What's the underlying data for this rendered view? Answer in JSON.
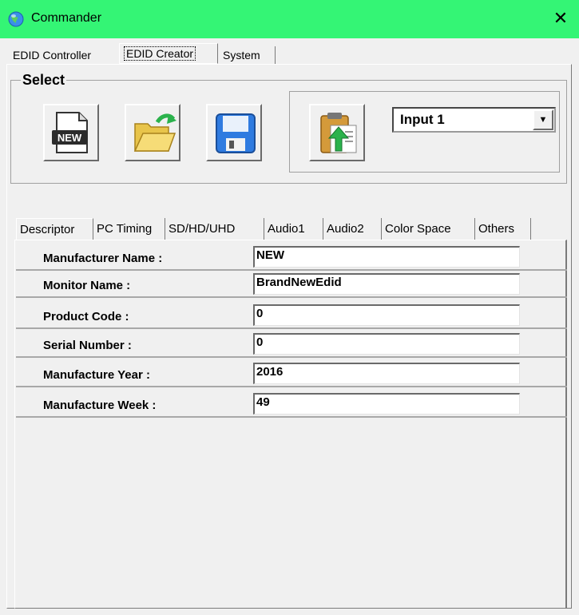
{
  "window": {
    "title": "Commander"
  },
  "main_tabs": [
    "EDID Controller",
    "EDID Creator",
    "System"
  ],
  "select_group": {
    "legend": "Select",
    "input_select": {
      "value": "Input 1"
    }
  },
  "tool_buttons": [
    {
      "name": "new-edid-button",
      "icon": "new-file-icon",
      "icon_text": "NEW"
    },
    {
      "name": "open-file-button",
      "icon": "open-folder-icon"
    },
    {
      "name": "save-file-button",
      "icon": "floppy-disk-icon"
    },
    {
      "name": "upload-edid-button",
      "icon": "clipboard-upload-icon"
    }
  ],
  "sub_tabs": [
    "Descriptor",
    "PC Timing",
    "SD/HD/UHD",
    "Audio1",
    "Audio2",
    "Color Space",
    "Others"
  ],
  "descriptor": {
    "rows": [
      {
        "label": "Manufacturer Name :",
        "value": "NEW"
      },
      {
        "label": "Monitor Name :",
        "value": "BrandNewEdid"
      },
      {
        "label": "Product Code :",
        "value": "0"
      },
      {
        "label": "Serial Number :",
        "value": "0"
      },
      {
        "label": "Manufacture Year :",
        "value": "2016"
      },
      {
        "label": "Manufacture Week :",
        "value": "49"
      }
    ]
  },
  "colors": {
    "titlebar": "#34f575",
    "window_bg": "#f0f0f0",
    "save_blue": "#2f7be0",
    "arrow_green": "#2bb24c"
  }
}
